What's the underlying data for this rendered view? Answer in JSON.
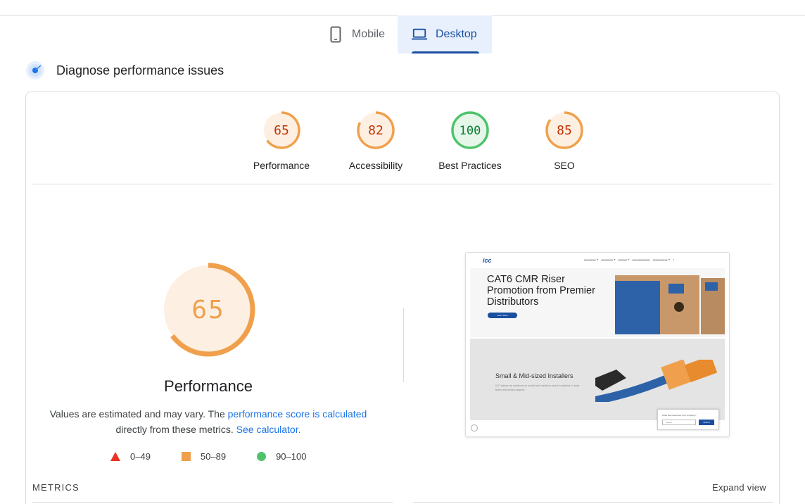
{
  "tabs": {
    "mobile": "Mobile",
    "desktop": "Desktop"
  },
  "section": {
    "title": "Diagnose performance issues"
  },
  "categories": [
    {
      "label": "Performance",
      "score": "65",
      "status": "average"
    },
    {
      "label": "Accessibility",
      "score": "82",
      "status": "average"
    },
    {
      "label": "Best Practices",
      "score": "100",
      "status": "pass"
    },
    {
      "label": "SEO",
      "score": "85",
      "status": "average"
    }
  ],
  "performance": {
    "score": "65",
    "title": "Performance",
    "desc_prefix": "Values are estimated and may vary. The ",
    "desc_link1": "performance score is calculated",
    "desc_mid": " directly from these metrics. ",
    "desc_link2": "See calculator."
  },
  "legend": {
    "fail": "0–49",
    "average": "50–89",
    "pass": "90–100"
  },
  "screenshot": {
    "logo": "icc",
    "hero_heading": "CAT6 CMR Riser Promotion from Premier Distributors",
    "hero_button": "Learn More",
    "section_heading": "Small & Mid-sized Installers",
    "section_text": "ICC tailors its solutions to small and medium-sized installers to help them win more projects.",
    "popup_question": "What best describes your company?",
    "popup_select": "- Select -",
    "popup_submit": "Submit"
  },
  "metrics": {
    "heading": "METRICS",
    "expand": "Expand view"
  },
  "colors": {
    "accent": "#1a4fa0",
    "average": "#f0a04c",
    "average_text": "#c33300",
    "pass": "#4dc46a",
    "pass_text": "#0a7d33",
    "fail": "#eb3323",
    "link": "#1a73e8"
  }
}
